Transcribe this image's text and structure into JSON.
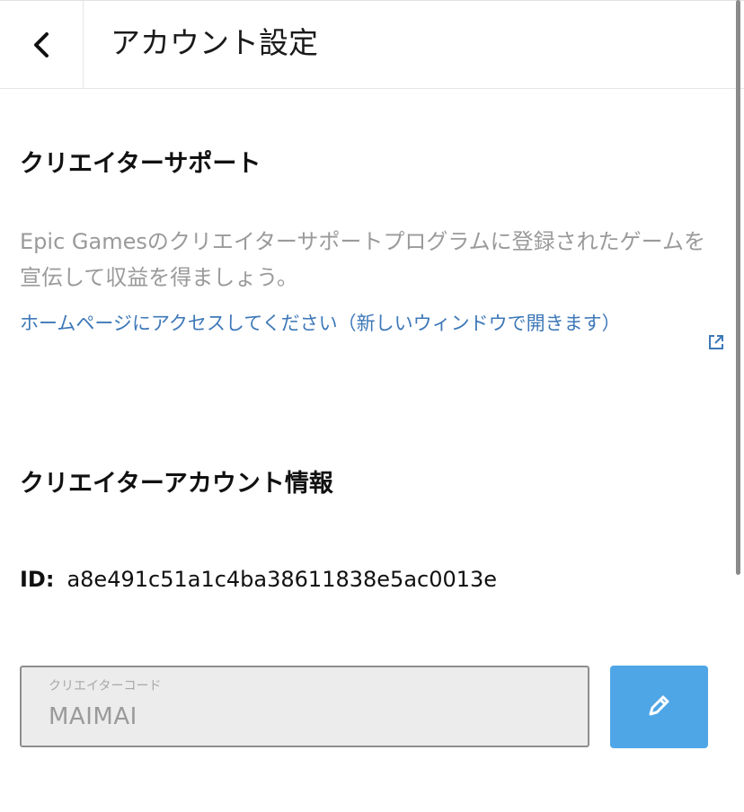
{
  "header": {
    "title": "アカウント設定",
    "back_icon": "chevron-left-icon"
  },
  "support": {
    "title": "クリエイターサポート",
    "description": "Epic Gamesのクリエイターサポートプログラムに登録されたゲームを宣伝して収益を得ましょう。",
    "link_text": "ホームページにアクセスしてください（新しいウィンドウで開きます）",
    "link_icon": "external-link-icon",
    "link_color": "#3d78b8"
  },
  "account": {
    "title": "クリエイターアカウント情報",
    "id_label": "ID:",
    "id_value": "a8e491c51a1c4ba38611838e5ac0013e"
  },
  "creator_code": {
    "label": "クリエイターコード",
    "value": "MAIMAI",
    "edit_icon": "pencil-icon",
    "edit_button_color": "#4ea6e6"
  }
}
